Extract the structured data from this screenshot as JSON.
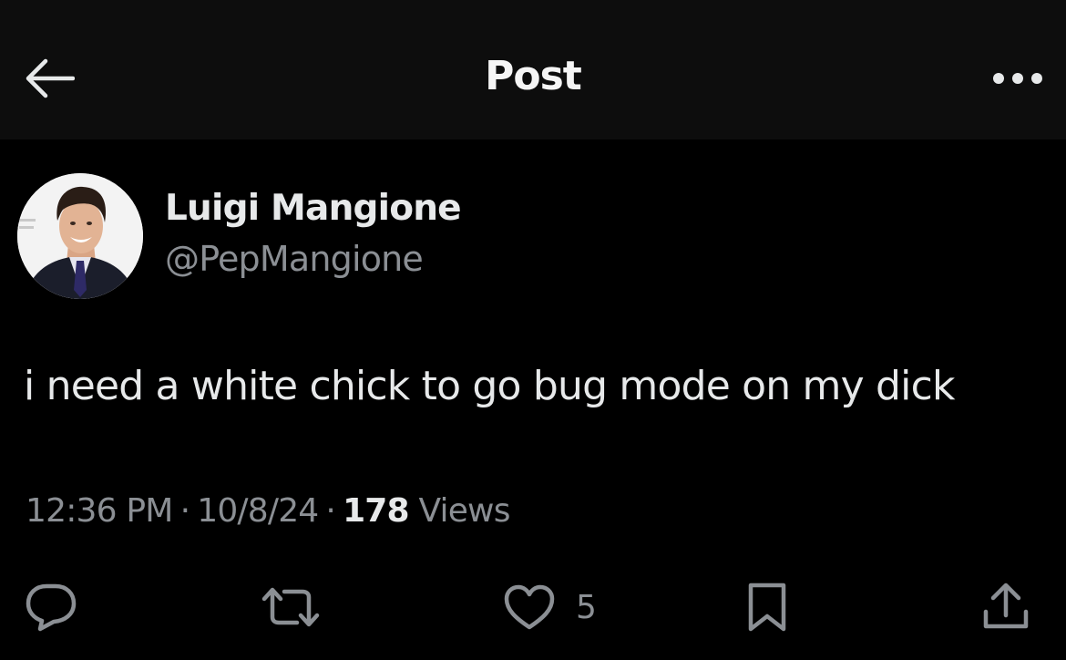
{
  "header": {
    "title": "Post",
    "back_icon": "arrow-left-icon",
    "more_icon": "more-horizontal-icon"
  },
  "author": {
    "name": "Luigi Mangione",
    "handle": "@PepMangione"
  },
  "post": {
    "text": "i need a white chick to go bug mode on my dick",
    "time": "12:36 PM",
    "date": "10/8/24",
    "views_count": "178",
    "views_label": "Views"
  },
  "actions": {
    "reply_icon": "reply-icon",
    "repost_icon": "repost-icon",
    "like_icon": "heart-icon",
    "like_count": "5",
    "bookmark_icon": "bookmark-icon",
    "share_icon": "share-icon"
  },
  "colors": {
    "background": "#000000",
    "header_background": "#0d0d0d",
    "primary_text": "#e7e9ea",
    "secondary_text": "#8b8f94"
  }
}
